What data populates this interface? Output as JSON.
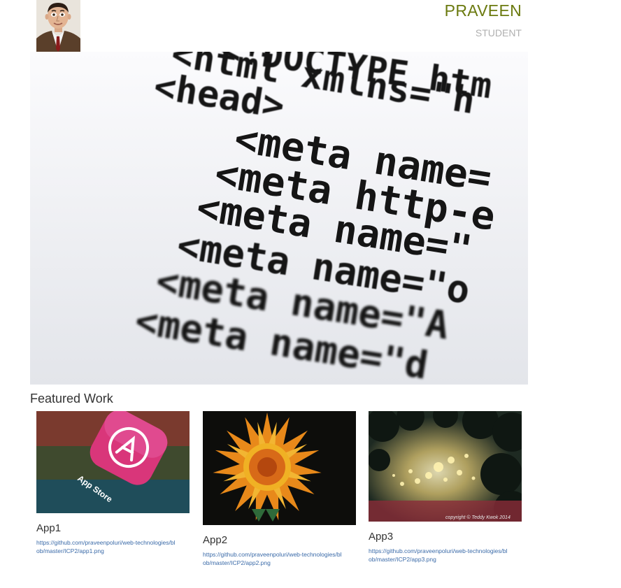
{
  "header": {
    "name": "PRAVEEN",
    "role": "STUDENT",
    "avatar_icon": "person-portrait-icon"
  },
  "hero": {
    "code_lines": [
      "<!DOCTYPE htm",
      "<html xmlns=\"h",
      "<head>",
      "<meta name=",
      "<meta http-e",
      "<meta name=\"",
      "<meta name=\"o",
      "<meta name=\"A",
      "<meta name=\"d"
    ]
  },
  "featured": {
    "title": "Featured Work",
    "items": [
      {
        "title": "App1",
        "link": "https://github.com/praveenpoluri/web-technologies/blob/master/ICP2/app1.png",
        "thumb_icon": "app-store-icon"
      },
      {
        "title": "App2",
        "link": "https://github.com/praveenpoluri/web-technologies/blob/master/ICP2/app2.png",
        "thumb_icon": "flower-icon"
      },
      {
        "title": "App3",
        "link": "https://github.com/praveenpoluri/web-technologies/blob/master/ICP2/app3.png",
        "thumb_icon": "bokeh-lights-icon",
        "watermark": "copyright © Teddy Kwok 2014"
      }
    ]
  },
  "colors": {
    "name": "#6b7a0f",
    "role": "#b0b0b0",
    "link": "#3a6aa8",
    "text": "#333333"
  }
}
